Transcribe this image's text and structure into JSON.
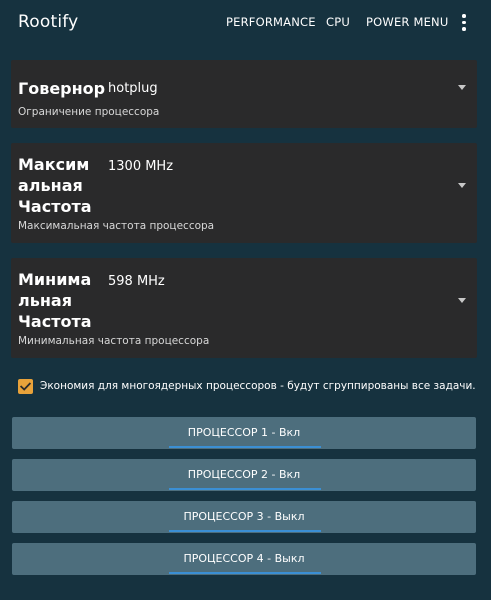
{
  "app": {
    "title": "Rootify"
  },
  "tabs": [
    {
      "label": "PERFORMANCE"
    },
    {
      "label": "CPU"
    },
    {
      "label": "POWER MENU"
    }
  ],
  "icons": {
    "overflow": "more-vert-icon",
    "dropdown": "arrow-drop-down-icon",
    "checkbox": "check-icon"
  },
  "colors": {
    "background": "#16323f",
    "card": "#2a2a2b",
    "checkbox_accent": "#e8a23a",
    "button": "#4d6e7d",
    "button_underline": "#3b8fd4"
  },
  "settings": {
    "governor": {
      "title": "Говернор",
      "value": "hotplug",
      "subtitle": "Ограничение процессора"
    },
    "max_freq": {
      "title": "Максимальная Частота",
      "value": "1300 MHz",
      "subtitle": "Максимальная частота процессора"
    },
    "min_freq": {
      "title": "Минимальная Частота",
      "value": "598 MHz",
      "subtitle": "Минимальная частота процессора"
    }
  },
  "multicore": {
    "checked": true,
    "label": "Экономия для многоядерных процессоров - будут сгруппированы все задачи."
  },
  "cpus": [
    {
      "label": "ПРОЦЕССОР 1 - Вкл"
    },
    {
      "label": "ПРОЦЕССОР 2 - Вкл"
    },
    {
      "label": "ПРОЦЕССОР 3 - Выкл"
    },
    {
      "label": "ПРОЦЕССОР 4 - Выкл"
    }
  ]
}
